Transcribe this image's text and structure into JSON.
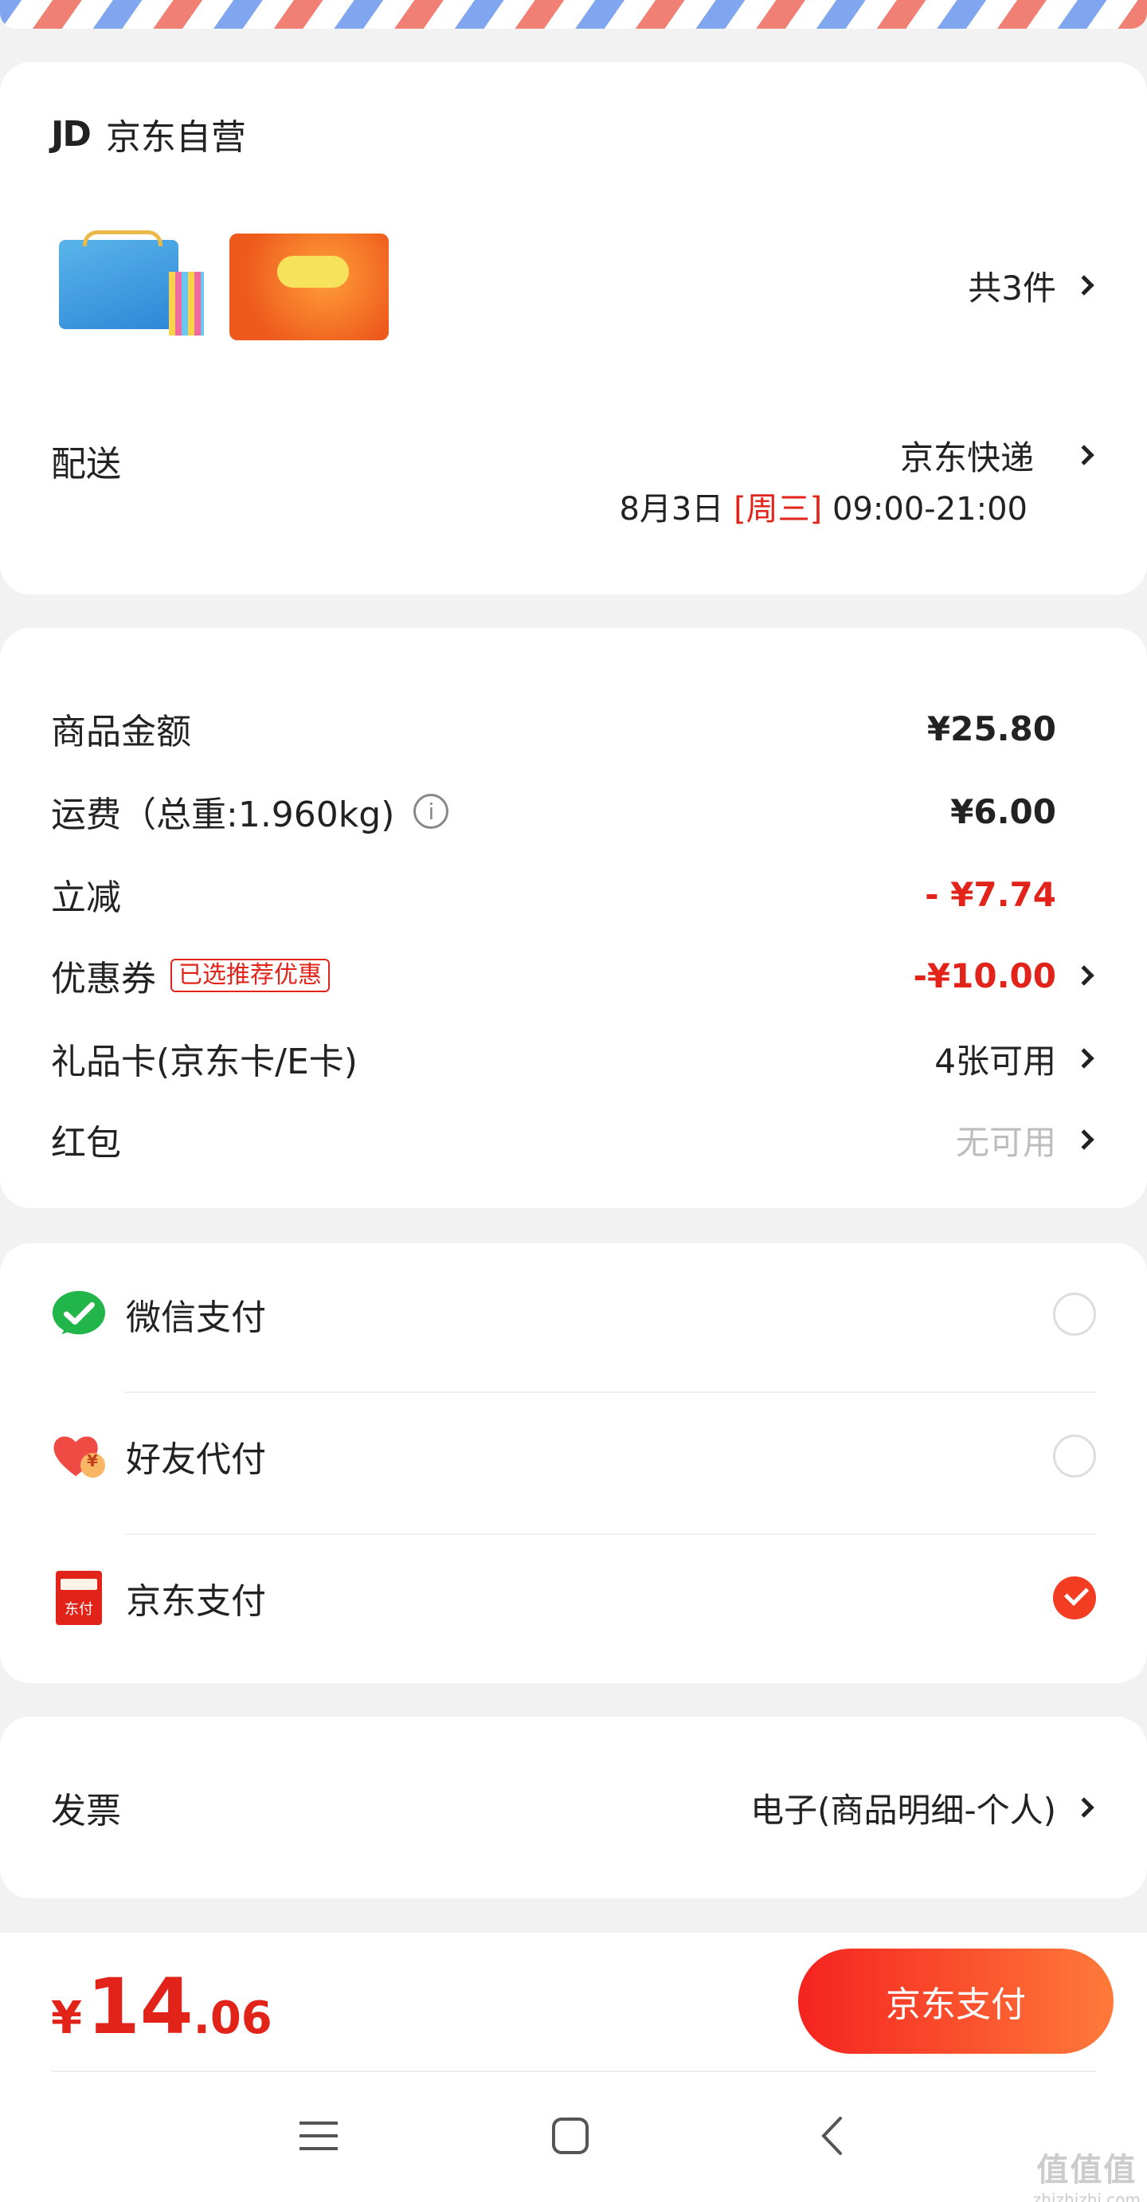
{
  "shop": {
    "logo_text": "JD",
    "name": "京东自营",
    "item_count": "共3件"
  },
  "delivery": {
    "label": "配送",
    "carrier": "京东快递",
    "date": "8月3日",
    "weekday": "[周三]",
    "time": "09:00-21:00"
  },
  "pricing": {
    "goods_label": "商品金额",
    "goods_value": "¥25.80",
    "freight_label": "运费（总重:1.960kg)",
    "freight_value": "¥6.00",
    "discount_label": "立减",
    "discount_value": "- ¥7.74",
    "coupon_label": "优惠券",
    "coupon_tag": "已选推荐优惠",
    "coupon_value": "-¥10.00",
    "giftcard_label": "礼品卡(京东卡/E卡)",
    "giftcard_value": "4张可用",
    "redpacket_label": "红包",
    "redpacket_value": "无可用"
  },
  "payment": {
    "options": [
      {
        "label": "微信支付",
        "icon": "wechat-pay-icon",
        "selected": false
      },
      {
        "label": "好友代付",
        "icon": "friend-pay-icon",
        "selected": false
      },
      {
        "label": "京东支付",
        "icon": "jd-pay-icon",
        "selected": true
      }
    ],
    "jd_icon_text": "东付",
    "friend_icon_text": "¥"
  },
  "invoice": {
    "label": "发票",
    "value": "电子(商品明细-个人)"
  },
  "footer": {
    "currency": "¥",
    "total_int": "14",
    "total_dec": ".06",
    "pay_button": "京东支付"
  },
  "watermark": {
    "line1": "值值值",
    "line2": "zhizhizhi.com"
  },
  "colors": {
    "accent": "#e2231a",
    "button_gradient_start": "#f5231f",
    "button_gradient_end": "#ff7a3a"
  }
}
